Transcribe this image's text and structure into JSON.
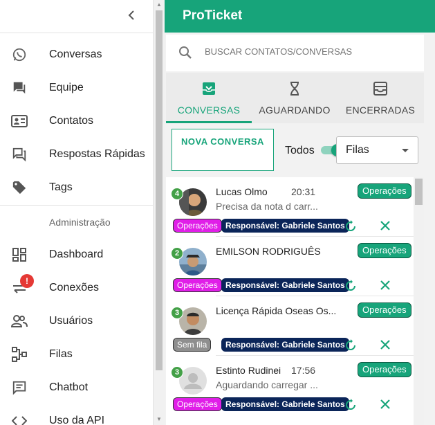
{
  "sidebar": {
    "section_label": "Administração",
    "items": [
      {
        "label": "Conversas",
        "icon": "whatsapp-icon"
      },
      {
        "label": "Equipe",
        "icon": "chat-icon"
      },
      {
        "label": "Contatos",
        "icon": "contact-card-icon"
      },
      {
        "label": "Respostas Rápidas",
        "icon": "quick-reply-icon"
      },
      {
        "label": "Tags",
        "icon": "tag-icon"
      },
      {
        "label": "Dashboard",
        "icon": "dashboard-icon"
      },
      {
        "label": "Conexões",
        "icon": "sync-arrows-icon",
        "badge": "!"
      },
      {
        "label": "Usuários",
        "icon": "people-icon"
      },
      {
        "label": "Filas",
        "icon": "queue-icon"
      },
      {
        "label": "Chatbot",
        "icon": "chatbot-icon"
      },
      {
        "label": "Uso da API",
        "icon": "code-icon"
      }
    ]
  },
  "header": {
    "title": "ProTicket"
  },
  "search": {
    "placeholder": "BUSCAR CONTATOS/CONVERSAS"
  },
  "tabs": [
    {
      "label": "CONVERSAS",
      "icon": "inbox-icon",
      "active": true
    },
    {
      "label": "AGUARDANDO",
      "icon": "hourglass-icon",
      "active": false
    },
    {
      "label": "ENCERRADAS",
      "icon": "archive-icon",
      "active": false
    }
  ],
  "actions": {
    "new_button": "NOVA CONVERSA",
    "todos_label": "Todos",
    "todos_on": true,
    "queue_select": "Filas"
  },
  "tickets": [
    {
      "count": "4",
      "name": "Lucas Olmo",
      "time": "20:31",
      "message": "Precisa da nota d carr...",
      "queue": "Operações",
      "tag": "Operações",
      "tag_color": "magenta",
      "responsible": "Responsável: Gabriele Santos"
    },
    {
      "count": "2",
      "name": "EMILSON RODRIGUÊS",
      "time": "",
      "message": "",
      "queue": "Operações",
      "tag": "Operações",
      "tag_color": "magenta",
      "responsible": "Responsável: Gabriele Santos"
    },
    {
      "count": "3",
      "name": "Licença Rápida Oseas Os...",
      "time": "",
      "message": "",
      "queue": "Operações",
      "tag": "Sem fila",
      "tag_color": "gray",
      "responsible": "Responsável: Gabriele Santos"
    },
    {
      "count": "3",
      "name": "Estinto Rudinei",
      "time": "17:56",
      "message": "Aguardando carregar ...",
      "queue": "Operações",
      "tag": "Operações",
      "tag_color": "magenta",
      "responsible": "Responsável: Gabriele Santos"
    }
  ],
  "colors": {
    "accent": "#17a47a",
    "responsible_bg": "#0b2559",
    "tag_magenta": "#e01ee8",
    "badge_red": "#e53935"
  }
}
